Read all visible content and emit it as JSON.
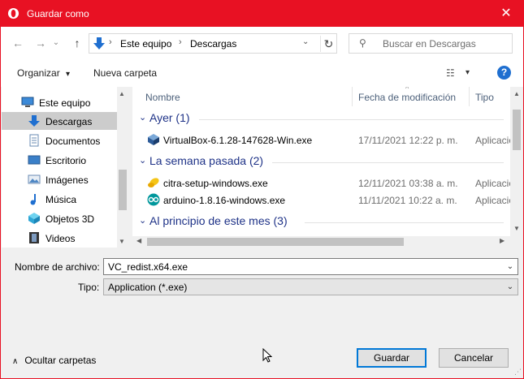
{
  "window": {
    "title": "Guardar como",
    "close_glyph": "✕",
    "icon": "opera-icon"
  },
  "nav": {
    "back_glyph": "←",
    "forward_glyph": "→",
    "recent_glyph": "⌄",
    "up_glyph": "↑",
    "breadcrumb": [
      "Este equipo",
      "Descargas"
    ],
    "breadcrumb_sep": "›",
    "address_dropdown_glyph": "⌄",
    "refresh_glyph": "↻",
    "search_glyph": "⚲",
    "search_placeholder": "Buscar en Descargas"
  },
  "toolbar": {
    "organize_label": "Organizar",
    "organize_chevron": "▾",
    "new_folder_label": "Nueva carpeta",
    "view_glyph": "☷",
    "view_chevron": "▾",
    "help_glyph": "?"
  },
  "sidebar": {
    "items": [
      {
        "label": "Este equipo",
        "icon": "computer-icon"
      },
      {
        "label": "Descargas",
        "icon": "downloads-icon",
        "selected": true
      },
      {
        "label": "Documentos",
        "icon": "documents-icon"
      },
      {
        "label": "Escritorio",
        "icon": "desktop-icon"
      },
      {
        "label": "Imágenes",
        "icon": "pictures-icon"
      },
      {
        "label": "Música",
        "icon": "music-icon"
      },
      {
        "label": "Objetos 3D",
        "icon": "3d-objects-icon"
      },
      {
        "label": "Videos",
        "icon": "videos-icon"
      }
    ],
    "scroll_up": "▲",
    "scroll_down": "▼"
  },
  "file_list": {
    "columns": {
      "name": "Nombre",
      "date": "Fecha de modificación",
      "type": "Tipo",
      "sort_glyph": "^"
    },
    "group_chevron": "⌄",
    "groups": [
      {
        "label": "Ayer (1)",
        "files": [
          {
            "name": "VirtualBox-6.1.28-147628-Win.exe",
            "date": "17/11/2021 12:22 p. m.",
            "type": "Aplicación",
            "icon": "virtualbox-icon"
          }
        ]
      },
      {
        "label": "La semana pasada (2)",
        "files": [
          {
            "name": "citra-setup-windows.exe",
            "date": "12/11/2021 03:38 a. m.",
            "type": "Aplicación",
            "icon": "citra-icon"
          },
          {
            "name": "arduino-1.8.16-windows.exe",
            "date": "11/11/2021 10:22 a. m.",
            "type": "Aplicación",
            "icon": "arduino-icon"
          }
        ]
      },
      {
        "label": "Al principio de este mes (3)",
        "files": []
      }
    ],
    "scroll_up": "▲",
    "scroll_down": "▼",
    "scroll_left": "◀",
    "scroll_right": "▶"
  },
  "form": {
    "filename_label": "Nombre de archivo:",
    "filename_value": "VC_redist.x64.exe",
    "type_label": "Tipo:",
    "type_value": "Application (*.exe)",
    "dropdown_glyph": "⌄"
  },
  "footer": {
    "hide_folders_chevron": "∧",
    "hide_folders_label": "Ocultar carpetas",
    "save_label": "Guardar",
    "cancel_label": "Cancelar",
    "grip_glyph": "⋰"
  },
  "colors": {
    "titlebar": "#e81123",
    "accent": "#0078d7",
    "group_header": "#1e3287"
  }
}
